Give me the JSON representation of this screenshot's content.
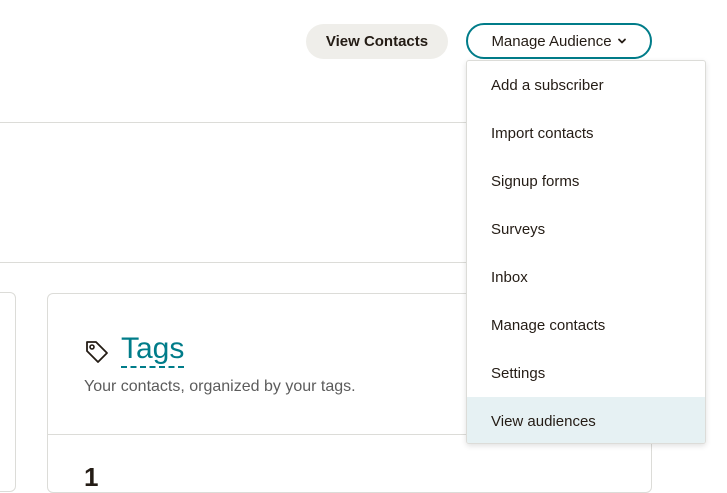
{
  "header": {
    "view_contacts_label": "View Contacts",
    "manage_audience_label": "Manage Audience"
  },
  "dropdown": {
    "items": [
      {
        "label": "Add a subscriber"
      },
      {
        "label": "Import contacts"
      },
      {
        "label": "Signup forms"
      },
      {
        "label": "Surveys"
      },
      {
        "label": "Inbox"
      },
      {
        "label": "Manage contacts"
      },
      {
        "label": "Settings"
      },
      {
        "label": "View audiences"
      }
    ],
    "highlighted_item": "View audiences"
  },
  "tags_card": {
    "title": "Tags",
    "description": "Your contacts, organized by your tags.",
    "partial_value": "1"
  },
  "colors": {
    "accent": "#007c89",
    "highlight": "#e6f1f3",
    "button_bg": "#efeeea",
    "text": "#241c15"
  },
  "icons": [
    "chevron-down-icon",
    "tag-icon"
  ]
}
